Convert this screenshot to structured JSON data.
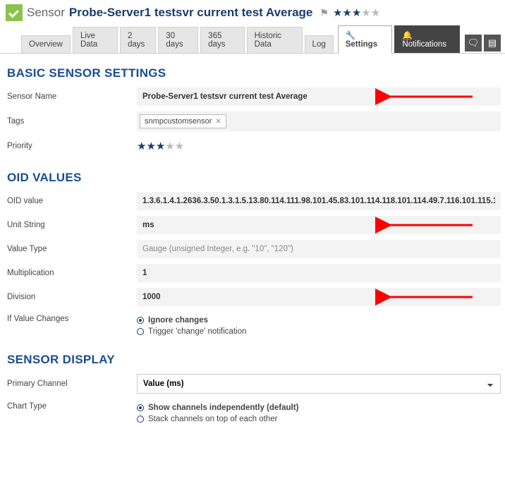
{
  "header": {
    "type_label": "Sensor",
    "title": "Probe-Server1 testsvr current test Average",
    "stars_full": 3,
    "stars_total": 5
  },
  "tabs": {
    "items": [
      {
        "label": "Overview"
      },
      {
        "label": "Live Data"
      },
      {
        "label": "2 days"
      },
      {
        "label": "30 days"
      },
      {
        "label": "365 days"
      },
      {
        "label": "Historic Data"
      },
      {
        "label": "Log"
      }
    ],
    "settings_label": "Settings",
    "notifications_label": "Notifications"
  },
  "sections": {
    "basic": {
      "title": "BASIC SENSOR SETTINGS",
      "sensor_name_label": "Sensor Name",
      "sensor_name_value": "Probe-Server1 testsvr current test Average",
      "tags_label": "Tags",
      "tag_value": "snmpcustomsensor",
      "priority_label": "Priority",
      "priority_stars": 3
    },
    "oid": {
      "title": "OID VALUES",
      "oid_value_label": "OID value",
      "oid_value": "1.3.6.1.4.1.2636.3.50.1.3.1.5.13.80.114.111.98.101.45.83.101.114.118.101.114.49.7.116.101.115.1",
      "unit_label": "Unit String",
      "unit_value": "ms",
      "value_type_label": "Value Type",
      "value_type_value": "Gauge (unsigned Integer, e.g. \"10\", \"120\")",
      "mult_label": "Multiplication",
      "mult_value": "1",
      "div_label": "Division",
      "div_value": "1000",
      "changes_label": "If Value Changes",
      "changes_opt1": "Ignore changes",
      "changes_opt2": "Trigger 'change' notification"
    },
    "display": {
      "title": "SENSOR DISPLAY",
      "primary_label": "Primary Channel",
      "primary_value": "Value (ms)",
      "chart_label": "Chart Type",
      "chart_opt1": "Show channels independently (default)",
      "chart_opt2": "Stack channels on top of each other"
    }
  }
}
